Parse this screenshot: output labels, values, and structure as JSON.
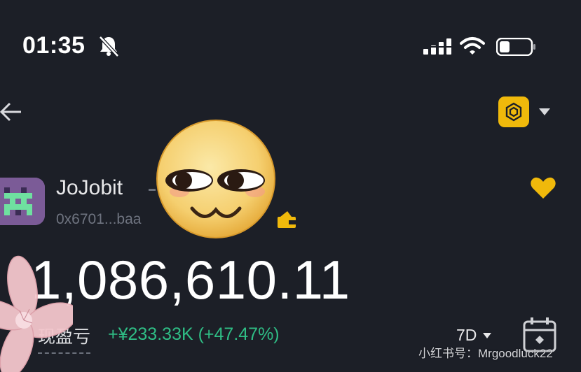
{
  "status_bar": {
    "time": "01:35",
    "icons": [
      "bell-off-icon",
      "cellular-signal-icon",
      "wifi-icon",
      "battery-icon"
    ]
  },
  "header": {
    "icons": [
      "back-arrow-icon",
      "bnb-chain-icon",
      "chevron-down-icon"
    ],
    "chain_color": "#f0b90b"
  },
  "profile": {
    "name": "JoJobit",
    "address": "0x6701...baa",
    "icons": [
      "avatar-pixel-art",
      "wallet-icon",
      "heart-icon"
    ],
    "heart_color": "#f0b90b"
  },
  "balance": {
    "value": "1,086,610.11"
  },
  "pnl": {
    "label": "现盈亏",
    "value": "+¥233.33K (+47.47%)",
    "color": "#2fbd85",
    "period": "7D"
  },
  "overlay": {
    "watermark": "小红书号：Mrgoodluck22",
    "stickers": [
      "smirking-face-emoji",
      "pink-flower-sticker"
    ]
  }
}
